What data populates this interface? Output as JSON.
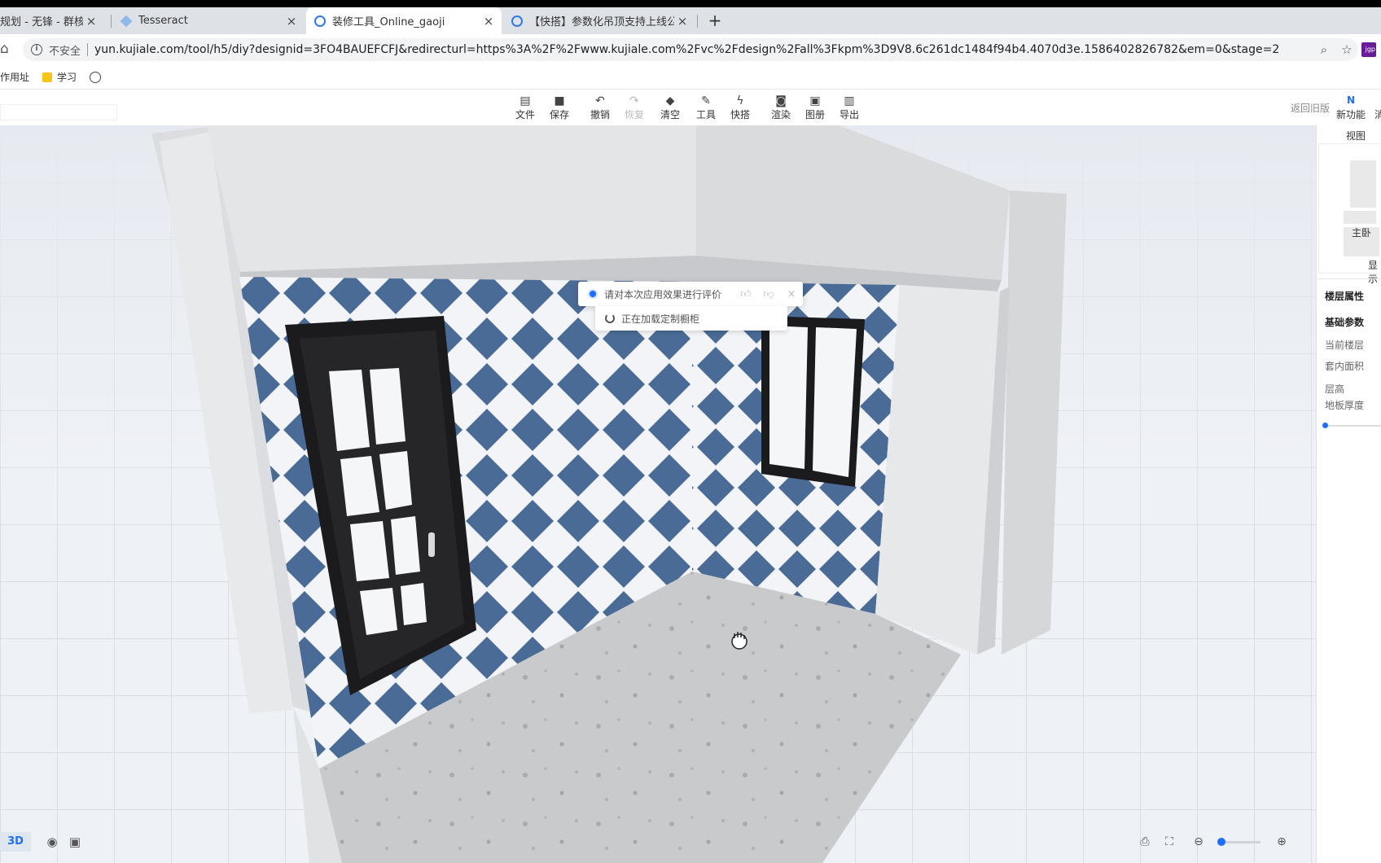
{
  "browser": {
    "tabs": [
      {
        "title": "规划 - 无锋 - 群核W",
        "active": false
      },
      {
        "title": "Tesseract",
        "active": false
      },
      {
        "title": "装修工具_Online_gaoji",
        "active": true
      },
      {
        "title": "【快搭】参数化吊顶支持上线公告",
        "active": false
      }
    ],
    "new_tab": "+",
    "close_glyph": "×",
    "insecure_label": "不安全",
    "url": "yun.kujiale.com/tool/h5/diy?designid=3FO4BAUEFCFJ&redirecturl=https%3A%2F%2Fwww.kujiale.com%2Fvc%2Fdesign%2Fall%3Fkpm%3D9V8.6c261dc1484f94b4.4070d3e.1586402826782&em=0&stage=2",
    "bookmarks": [
      {
        "label": "工作用址"
      },
      {
        "label": "学习"
      }
    ],
    "ext_badge": "jgp"
  },
  "toolbar": {
    "tools": [
      {
        "label": "文件",
        "icon": "file-icon",
        "glyph": "▤",
        "disabled": false
      },
      {
        "label": "保存",
        "icon": "save-icon",
        "glyph": "■",
        "disabled": false
      },
      {
        "label": "撤销",
        "icon": "undo-icon",
        "glyph": "↶",
        "disabled": false
      },
      {
        "label": "恢复",
        "icon": "redo-icon",
        "glyph": "↷",
        "disabled": true
      },
      {
        "label": "清空",
        "icon": "eraser-icon",
        "glyph": "◆",
        "disabled": false
      },
      {
        "label": "工具",
        "icon": "wrench-icon",
        "glyph": "✎",
        "disabled": false
      },
      {
        "label": "快搭",
        "icon": "lightning-icon",
        "glyph": "ϟ",
        "disabled": false
      },
      {
        "label": "渲染",
        "icon": "camera-icon",
        "glyph": "◙",
        "disabled": false
      },
      {
        "label": "图册",
        "icon": "album-icon",
        "glyph": "▣",
        "disabled": false
      },
      {
        "label": "导出",
        "icon": "export-icon",
        "glyph": "▥",
        "disabled": false
      }
    ],
    "back_old": "返回旧版",
    "new_feature": "新功能",
    "new_feature_glyph": "N",
    "edge_text": "消"
  },
  "scene": {
    "rating_prompt": "请对本次应用效果进行评价",
    "loading_text": "正在加载定制橱柜",
    "mode_3d": "3D",
    "colors": {
      "tile_blue": "#4a6b95",
      "tile_white": "#f2f4f7",
      "door": "#1b1b1d",
      "wall": "#e6e7e9",
      "floor": "#c9cacc"
    }
  },
  "zoom": {
    "level": 0.08
  },
  "panel": {
    "view_title": "视图",
    "room_label": "主卧",
    "show_label": "显示",
    "floor_props": "楼层属性",
    "basic_params": "基础参数",
    "rows": [
      "当前楼层",
      "套内面积",
      "层高",
      "地板厚度"
    ]
  }
}
